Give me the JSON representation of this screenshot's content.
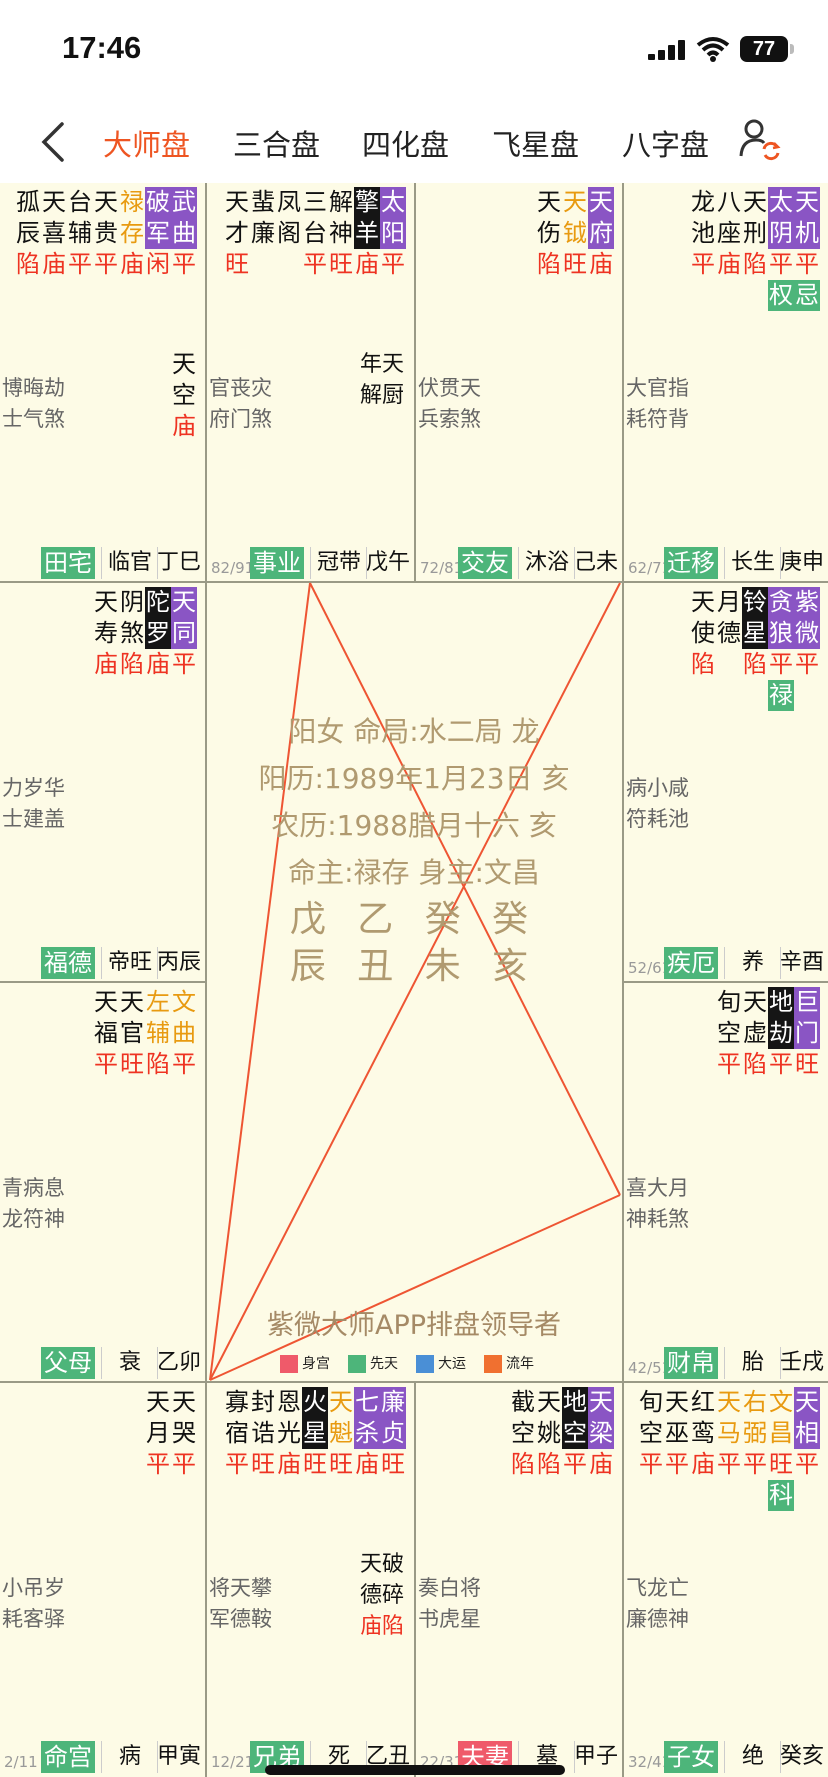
{
  "status": {
    "time": "17:46",
    "battery": "77"
  },
  "nav": {
    "tabs": [
      {
        "label": "大师盘",
        "active": true
      },
      {
        "label": "三合盘",
        "active": false
      },
      {
        "label": "四化盘",
        "active": false
      },
      {
        "label": "飞星盘",
        "active": false
      },
      {
        "label": "八字盘",
        "active": false
      }
    ]
  },
  "center": {
    "line1": "阳女 命局:水二局 龙",
    "line2": "阳历:1989年1月23日 亥",
    "line3": "农历:1988腊月十六 亥",
    "line4": "命主:禄存 身主:文昌",
    "gan": "戊 乙 癸 癸",
    "zhi": "辰 丑 未 亥",
    "footer": "紫微大师APP排盘领导者",
    "legend": [
      {
        "label": "身宫",
        "color": "#ef5a6a"
      },
      {
        "label": "先天",
        "color": "#4db57a"
      },
      {
        "label": "大运",
        "color": "#4a8fd6"
      },
      {
        "label": "流年",
        "color": "#f07030"
      }
    ]
  },
  "colors": {
    "accent": "#ee5522",
    "green": "#4db57a",
    "purple": "#8a55c4",
    "brightness": "#ee3322"
  },
  "palaces": {
    "si": {
      "stars": [
        {
          "c": "孤辰",
          "b": "陷"
        },
        {
          "c": "天喜",
          "b": "庙"
        },
        {
          "c": "台辅",
          "b": "平"
        },
        {
          "c": "天贵",
          "b": "平"
        },
        {
          "c": "禄存",
          "b": "庙",
          "s": "gold"
        },
        {
          "c": "破军",
          "b": "闲",
          "s": "bp"
        },
        {
          "c": "武曲",
          "b": "平",
          "s": "bp"
        }
      ],
      "minor": [
        "博晦劫",
        "士气煞"
      ],
      "extra": [
        {
          "c": "天空",
          "b": "庙"
        }
      ],
      "range": "",
      "name": "田宅",
      "state": "临官",
      "gz": "丁巳"
    },
    "wu": {
      "stars": [
        {
          "c": "天才",
          "b": "旺"
        },
        {
          "c": "蜚廉",
          "b": ""
        },
        {
          "c": "凤阁",
          "b": ""
        },
        {
          "c": "三台",
          "b": "平"
        },
        {
          "c": "解神",
          "b": "旺"
        },
        {
          "c": "擎羊",
          "b": "庙",
          "s": "bm"
        },
        {
          "c": "太阳",
          "b": "平",
          "s": "bp",
          "b2": "庙"
        }
      ],
      "minor": [
        "官丧灾",
        "府门煞"
      ],
      "extra2": [
        "年天",
        "解厨"
      ],
      "range": "82/91",
      "name": "事业",
      "state": "冠带",
      "gz": "戊午"
    },
    "wei": {
      "stars": [
        {
          "c": "天伤",
          "b": "陷"
        },
        {
          "c": "天钺",
          "b": "旺",
          "s": "gold"
        },
        {
          "c": "天府",
          "b": "庙",
          "s": "bp"
        }
      ],
      "minor": [
        "伏贯天",
        "兵索煞"
      ],
      "range": "72/81",
      "name": "交友",
      "state": "沐浴",
      "gz": "己未"
    },
    "shen": {
      "stars": [
        {
          "c": "龙池",
          "b": "平"
        },
        {
          "c": "八座",
          "b": "庙"
        },
        {
          "c": "天刑",
          "b": "陷"
        },
        {
          "c": "太阴",
          "b": "平",
          "s": "bp",
          "h": "权"
        },
        {
          "c": "天机",
          "b": "平",
          "s": "bp",
          "h": "忌"
        }
      ],
      "minor": [
        "大官指",
        "耗符背"
      ],
      "range": "62/71",
      "name": "迁移",
      "state": "长生",
      "gz": "庚申"
    },
    "chen": {
      "stars": [
        {
          "c": "天寿",
          "b": "庙"
        },
        {
          "c": "阴煞",
          "b": "陷"
        },
        {
          "c": "陀罗",
          "b": "庙",
          "s": "bm"
        },
        {
          "c": "天同",
          "b": "平",
          "s": "bp"
        }
      ],
      "minor": [
        "力岁华",
        "士建盖"
      ],
      "range": "",
      "name": "福德",
      "state": "帝旺",
      "gz": "丙辰"
    },
    "you": {
      "stars": [
        {
          "c": "天使",
          "b": "陷"
        },
        {
          "c": "月德",
          "b": ""
        },
        {
          "c": "铃星",
          "b": "陷",
          "s": "bm"
        },
        {
          "c": "贪狼",
          "b": "平",
          "s": "bp",
          "h": "禄"
        },
        {
          "c": "紫微",
          "b": "平",
          "s": "bp"
        }
      ],
      "minor": [
        "病小咸",
        "符耗池"
      ],
      "range": "52/61",
      "name": "疾厄",
      "state": "养",
      "gz": "辛酉"
    },
    "mao": {
      "stars": [
        {
          "c": "天福",
          "b": "平"
        },
        {
          "c": "天官",
          "b": "旺"
        },
        {
          "c": "左辅",
          "b": "陷",
          "s": "gold"
        },
        {
          "c": "文曲",
          "b": "平",
          "s": "gold"
        }
      ],
      "minor": [
        "青病息",
        "龙符神"
      ],
      "range": "",
      "name": "父母",
      "state": "衰",
      "gz": "乙卯"
    },
    "xu": {
      "stars": [
        {
          "c": "旬空",
          "b": "平"
        },
        {
          "c": "天虚",
          "b": "陷"
        },
        {
          "c": "地劫",
          "b": "平",
          "s": "bm"
        },
        {
          "c": "巨门",
          "b": "旺",
          "s": "bp"
        }
      ],
      "minor": [
        "喜大月",
        "神耗煞"
      ],
      "range": "42/51",
      "name": "财帛",
      "state": "胎",
      "gz": "壬戌"
    },
    "yin": {
      "stars": [
        {
          "c": "天月",
          "b": "平"
        },
        {
          "c": "天哭",
          "b": "平"
        }
      ],
      "minor": [
        "小吊岁",
        "耗客驿"
      ],
      "range": "2/11",
      "name": "命宫",
      "state": "病",
      "gz": "甲寅"
    },
    "chou": {
      "stars": [
        {
          "c": "寡宿",
          "b": "平"
        },
        {
          "c": "封诰",
          "b": "旺"
        },
        {
          "c": "恩光",
          "b": "庙"
        },
        {
          "c": "火星",
          "b": "旺",
          "s": "bm"
        },
        {
          "c": "天魁",
          "b": "旺",
          "s": "gold"
        },
        {
          "c": "七杀",
          "b": "庙",
          "s": "bp"
        },
        {
          "c": "廉贞",
          "b": "旺",
          "s": "bp"
        }
      ],
      "minor": [
        "将天攀",
        "军德鞍"
      ],
      "extra3": [
        {
          "c": "天德",
          "b": "庙"
        },
        {
          "c": "破碎",
          "b": "陷"
        }
      ],
      "range": "12/21",
      "name": "兄弟",
      "state": "死",
      "gz": "乙丑"
    },
    "zi": {
      "stars": [
        {
          "c": "截空",
          "b": "陷"
        },
        {
          "c": "天姚",
          "b": "陷"
        },
        {
          "c": "地空",
          "b": "平",
          "s": "bm"
        },
        {
          "c": "天梁",
          "b": "庙",
          "s": "bp"
        }
      ],
      "minor": [
        "奏白将",
        "书虎星"
      ],
      "range": "22/31",
      "name": "夫妻",
      "state": "墓",
      "gz": "甲子",
      "red": true
    },
    "hai": {
      "stars": [
        {
          "c": "旬空",
          "b": "平"
        },
        {
          "c": "天巫",
          "b": "平"
        },
        {
          "c": "红鸾",
          "b": "庙"
        },
        {
          "c": "天马",
          "b": "平",
          "s": "gold"
        },
        {
          "c": "右弼",
          "b": "平",
          "s": "gold"
        },
        {
          "c": "文昌",
          "b": "旺",
          "s": "gold",
          "h": "科"
        },
        {
          "c": "天相",
          "b": "平",
          "s": "bp"
        }
      ],
      "minor": [
        "飞龙亡",
        "廉德神"
      ],
      "range": "32/41",
      "name": "子女",
      "state": "绝",
      "gz": "癸亥"
    }
  }
}
